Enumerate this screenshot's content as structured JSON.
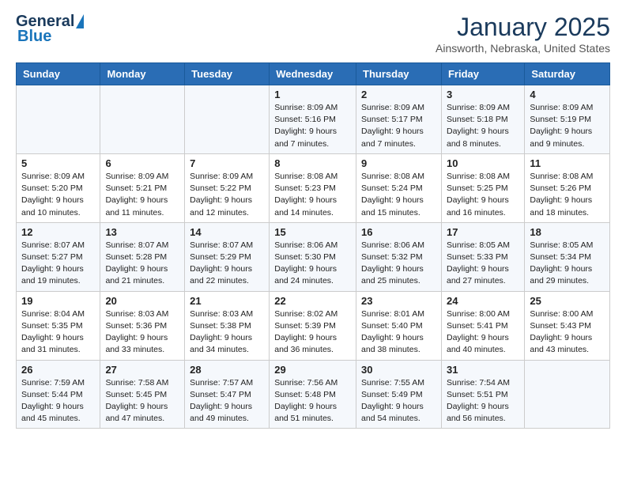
{
  "header": {
    "logo_general": "General",
    "logo_blue": "Blue",
    "month_title": "January 2025",
    "location": "Ainsworth, Nebraska, United States"
  },
  "weekdays": [
    "Sunday",
    "Monday",
    "Tuesday",
    "Wednesday",
    "Thursday",
    "Friday",
    "Saturday"
  ],
  "weeks": [
    [
      {
        "day": "",
        "info": ""
      },
      {
        "day": "",
        "info": ""
      },
      {
        "day": "",
        "info": ""
      },
      {
        "day": "1",
        "info": "Sunrise: 8:09 AM\nSunset: 5:16 PM\nDaylight: 9 hours\nand 7 minutes."
      },
      {
        "day": "2",
        "info": "Sunrise: 8:09 AM\nSunset: 5:17 PM\nDaylight: 9 hours\nand 7 minutes."
      },
      {
        "day": "3",
        "info": "Sunrise: 8:09 AM\nSunset: 5:18 PM\nDaylight: 9 hours\nand 8 minutes."
      },
      {
        "day": "4",
        "info": "Sunrise: 8:09 AM\nSunset: 5:19 PM\nDaylight: 9 hours\nand 9 minutes."
      }
    ],
    [
      {
        "day": "5",
        "info": "Sunrise: 8:09 AM\nSunset: 5:20 PM\nDaylight: 9 hours\nand 10 minutes."
      },
      {
        "day": "6",
        "info": "Sunrise: 8:09 AM\nSunset: 5:21 PM\nDaylight: 9 hours\nand 11 minutes."
      },
      {
        "day": "7",
        "info": "Sunrise: 8:09 AM\nSunset: 5:22 PM\nDaylight: 9 hours\nand 12 minutes."
      },
      {
        "day": "8",
        "info": "Sunrise: 8:08 AM\nSunset: 5:23 PM\nDaylight: 9 hours\nand 14 minutes."
      },
      {
        "day": "9",
        "info": "Sunrise: 8:08 AM\nSunset: 5:24 PM\nDaylight: 9 hours\nand 15 minutes."
      },
      {
        "day": "10",
        "info": "Sunrise: 8:08 AM\nSunset: 5:25 PM\nDaylight: 9 hours\nand 16 minutes."
      },
      {
        "day": "11",
        "info": "Sunrise: 8:08 AM\nSunset: 5:26 PM\nDaylight: 9 hours\nand 18 minutes."
      }
    ],
    [
      {
        "day": "12",
        "info": "Sunrise: 8:07 AM\nSunset: 5:27 PM\nDaylight: 9 hours\nand 19 minutes."
      },
      {
        "day": "13",
        "info": "Sunrise: 8:07 AM\nSunset: 5:28 PM\nDaylight: 9 hours\nand 21 minutes."
      },
      {
        "day": "14",
        "info": "Sunrise: 8:07 AM\nSunset: 5:29 PM\nDaylight: 9 hours\nand 22 minutes."
      },
      {
        "day": "15",
        "info": "Sunrise: 8:06 AM\nSunset: 5:30 PM\nDaylight: 9 hours\nand 24 minutes."
      },
      {
        "day": "16",
        "info": "Sunrise: 8:06 AM\nSunset: 5:32 PM\nDaylight: 9 hours\nand 25 minutes."
      },
      {
        "day": "17",
        "info": "Sunrise: 8:05 AM\nSunset: 5:33 PM\nDaylight: 9 hours\nand 27 minutes."
      },
      {
        "day": "18",
        "info": "Sunrise: 8:05 AM\nSunset: 5:34 PM\nDaylight: 9 hours\nand 29 minutes."
      }
    ],
    [
      {
        "day": "19",
        "info": "Sunrise: 8:04 AM\nSunset: 5:35 PM\nDaylight: 9 hours\nand 31 minutes."
      },
      {
        "day": "20",
        "info": "Sunrise: 8:03 AM\nSunset: 5:36 PM\nDaylight: 9 hours\nand 33 minutes."
      },
      {
        "day": "21",
        "info": "Sunrise: 8:03 AM\nSunset: 5:38 PM\nDaylight: 9 hours\nand 34 minutes."
      },
      {
        "day": "22",
        "info": "Sunrise: 8:02 AM\nSunset: 5:39 PM\nDaylight: 9 hours\nand 36 minutes."
      },
      {
        "day": "23",
        "info": "Sunrise: 8:01 AM\nSunset: 5:40 PM\nDaylight: 9 hours\nand 38 minutes."
      },
      {
        "day": "24",
        "info": "Sunrise: 8:00 AM\nSunset: 5:41 PM\nDaylight: 9 hours\nand 40 minutes."
      },
      {
        "day": "25",
        "info": "Sunrise: 8:00 AM\nSunset: 5:43 PM\nDaylight: 9 hours\nand 43 minutes."
      }
    ],
    [
      {
        "day": "26",
        "info": "Sunrise: 7:59 AM\nSunset: 5:44 PM\nDaylight: 9 hours\nand 45 minutes."
      },
      {
        "day": "27",
        "info": "Sunrise: 7:58 AM\nSunset: 5:45 PM\nDaylight: 9 hours\nand 47 minutes."
      },
      {
        "day": "28",
        "info": "Sunrise: 7:57 AM\nSunset: 5:47 PM\nDaylight: 9 hours\nand 49 minutes."
      },
      {
        "day": "29",
        "info": "Sunrise: 7:56 AM\nSunset: 5:48 PM\nDaylight: 9 hours\nand 51 minutes."
      },
      {
        "day": "30",
        "info": "Sunrise: 7:55 AM\nSunset: 5:49 PM\nDaylight: 9 hours\nand 54 minutes."
      },
      {
        "day": "31",
        "info": "Sunrise: 7:54 AM\nSunset: 5:51 PM\nDaylight: 9 hours\nand 56 minutes."
      },
      {
        "day": "",
        "info": ""
      }
    ]
  ]
}
